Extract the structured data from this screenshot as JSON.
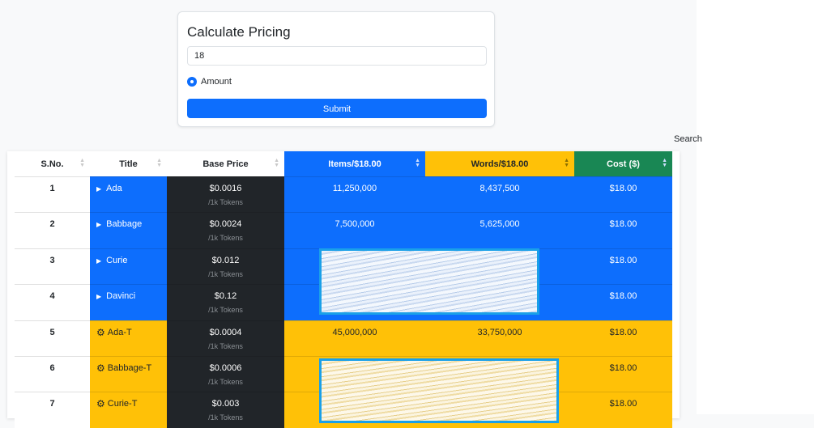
{
  "form": {
    "title": "Calculate Pricing",
    "amount_value": "18",
    "radio_label": "Amount",
    "submit_label": "Submit"
  },
  "search_label": "Search",
  "colors": {
    "blue": "#0d6efd",
    "yellow": "#ffc107",
    "green": "#198754",
    "dark": "#212529"
  },
  "table": {
    "headers": [
      "S.No.",
      "Title",
      "Base Price",
      "Items/$18.00",
      "Words/$18.00",
      "Cost ($)"
    ],
    "rows": [
      {
        "sno": "1",
        "title": "Ada",
        "price": "$0.0016",
        "unit": "/1k Tokens",
        "items": "11,250,000",
        "words": "8,437,500",
        "cost": "$18.00"
      },
      {
        "sno": "2",
        "title": "Babbage",
        "price": "$0.0024",
        "unit": "/1k Tokens",
        "items": "7,500,000",
        "words": "5,625,000",
        "cost": "$18.00"
      },
      {
        "sno": "3",
        "title": "Curie",
        "price": "$0.012",
        "unit": "/1k Tokens",
        "items": "",
        "words": "",
        "cost": "$18.00"
      },
      {
        "sno": "4",
        "title": "Davinci",
        "price": "$0.12",
        "unit": "/1k Tokens",
        "items": "",
        "words": "",
        "cost": "$18.00"
      },
      {
        "sno": "5",
        "title": "Ada-T",
        "price": "$0.0004",
        "unit": "/1k Tokens",
        "items": "45,000,000",
        "words": "33,750,000",
        "cost": "$18.00"
      },
      {
        "sno": "6",
        "title": "Babbage-T",
        "price": "$0.0006",
        "unit": "/1k Tokens",
        "items": "",
        "words": "",
        "cost": "$18.00"
      },
      {
        "sno": "7",
        "title": "Curie-T",
        "price": "$0.003",
        "unit": "/1k Tokens",
        "items": "",
        "words": "",
        "cost": "$18.00"
      }
    ]
  }
}
